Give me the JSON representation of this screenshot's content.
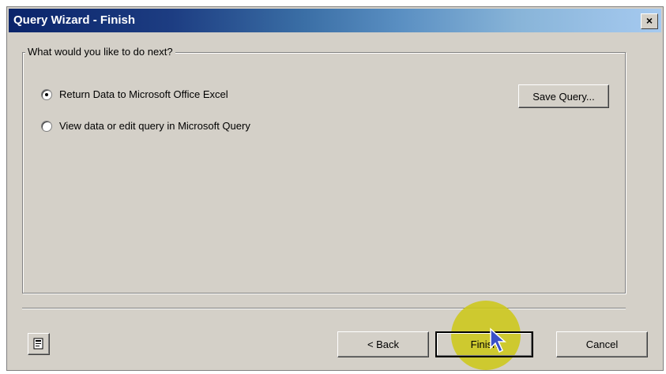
{
  "dialog": {
    "title": "Query Wizard - Finish",
    "close_label": "×"
  },
  "group": {
    "legend": "What would you like to do next?"
  },
  "options": [
    {
      "label": "Return Data to Microsoft Office Excel",
      "selected": true
    },
    {
      "label": "View data or edit query in Microsoft Query",
      "selected": false
    }
  ],
  "buttons": {
    "save_query": "Save Query...",
    "back": "< Back",
    "finish": "Finish",
    "cancel": "Cancel"
  },
  "icons": {
    "help": "help-icon",
    "cursor": "mouse-pointer-icon"
  },
  "colors": {
    "dialog_bg": "#d4d0c8",
    "title_start": "#0a246a",
    "title_end": "#a6caf0",
    "click_highlight": "#cdc814"
  }
}
